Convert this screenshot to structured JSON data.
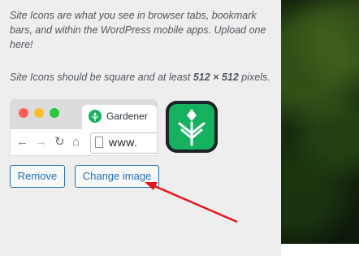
{
  "description": {
    "line1": "Site Icons are what you see in browser tabs, bookmark bars, and within the WordPress mobile apps. Upload one here!",
    "line2_prefix": "Site Icons should be square and at least ",
    "line2_bold": "512 × 512",
    "line2_suffix": " pixels."
  },
  "preview": {
    "tab_title": "Gardener",
    "url_text": "www."
  },
  "buttons": {
    "remove_label": "Remove",
    "change_label": "Change image"
  },
  "colors": {
    "brand_green": "#15b15e",
    "button_blue": "#2271b1",
    "annotation_red": "#e3161b"
  }
}
